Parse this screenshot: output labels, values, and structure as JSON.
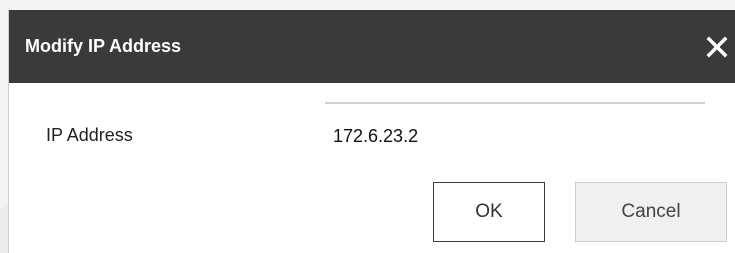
{
  "dialog": {
    "title": "Modify IP Address",
    "field": {
      "label": "IP Address",
      "value": "172.6.23.2"
    },
    "buttons": {
      "ok": "OK",
      "cancel": "Cancel"
    }
  },
  "icons": {
    "close": "close-icon",
    "watermark": "camera-watermark-icon"
  },
  "colors": {
    "titlebar": "#3a3a3a",
    "title_text": "#ffffff",
    "dialog_background": "#ffffff",
    "ok_border": "#3c3c3c",
    "cancel_background": "#f0f0f0"
  }
}
